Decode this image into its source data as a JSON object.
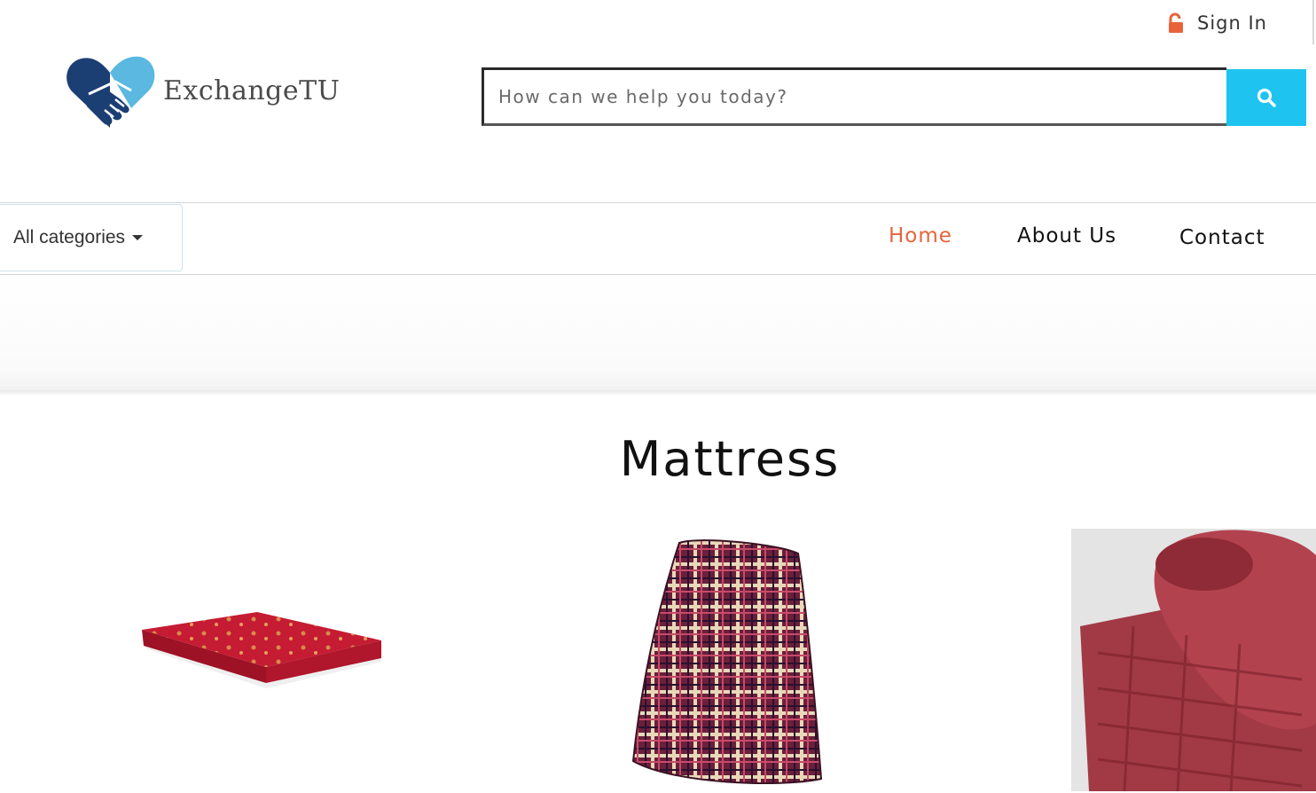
{
  "header": {
    "sign_in_label": "Sign In",
    "logo_text": "ExchangeTU",
    "search_placeholder": "How can we help you today?"
  },
  "nav": {
    "categories_label": "All categories",
    "links": [
      {
        "label": "Home",
        "active": true
      },
      {
        "label": "About Us",
        "active": false
      },
      {
        "label": "Contact",
        "active": false
      }
    ]
  },
  "section": {
    "title": "Mattress"
  },
  "colors": {
    "accent_orange": "#e8633a",
    "search_button": "#1ec3f0",
    "logo_dark_blue": "#1b3f73",
    "logo_light_blue": "#5bb8e0"
  },
  "icons": {
    "sign_in": "lock-open-icon",
    "search": "search-icon",
    "dropdown": "caret-down-icon"
  },
  "products": [
    {
      "name": "red-mattress-flat"
    },
    {
      "name": "plaid-mattress"
    },
    {
      "name": "rolled-red-mattress"
    }
  ]
}
